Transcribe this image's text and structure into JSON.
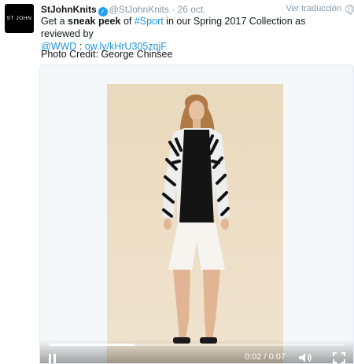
{
  "avatar": {
    "text": "ST JOHN"
  },
  "header": {
    "name": "StJohnKnits",
    "handle": "@StJohnKnits",
    "separator": "·",
    "date": "26 oct.",
    "translate": "Ver traducción"
  },
  "tweet": {
    "part1": "Get a ",
    "bold": "sneak peek",
    "part2": " of ",
    "hashtag": "#Sport",
    "part3": " in our Spring 2017 Collection as reviewed by",
    "mention": "@WWD",
    "colon": " : ",
    "link": "ow.ly/kHrU305zqjF",
    "credit": "Photo Credit: George Chinsee"
  },
  "video": {
    "time": "0:02 / 0:07",
    "progress": 0.29
  },
  "colors": {
    "link": "#1b95e0",
    "verified": "#1da1f2",
    "meta": "#8899a6"
  }
}
